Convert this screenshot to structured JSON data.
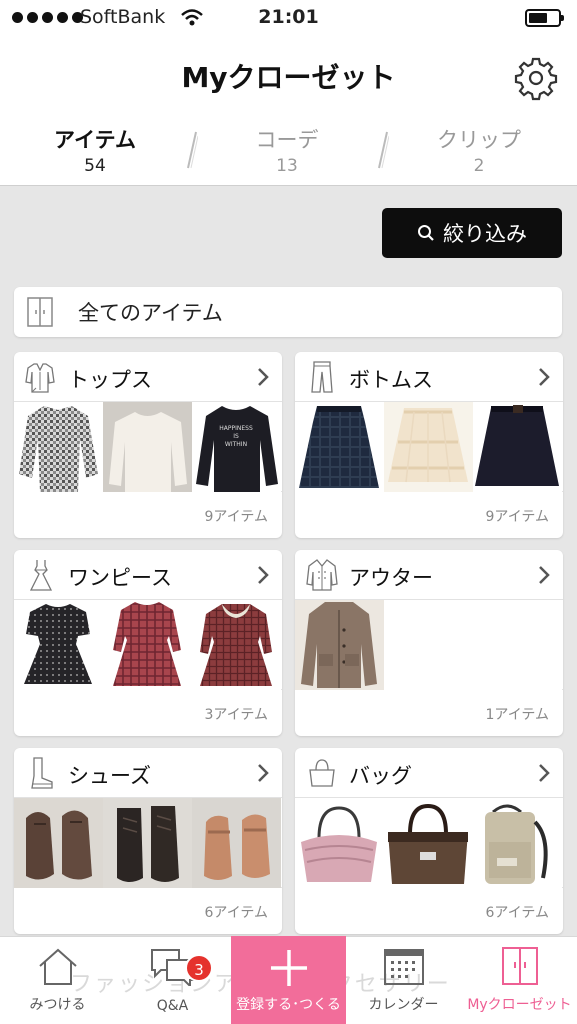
{
  "status_bar": {
    "carrier": "SoftBank",
    "time": "21:01"
  },
  "header": {
    "title": "Myクローゼット"
  },
  "tabs": [
    {
      "label": "アイテム",
      "count": "54",
      "active": true
    },
    {
      "label": "コーデ",
      "count": "13",
      "active": false
    },
    {
      "label": "クリップ",
      "count": "2",
      "active": false
    }
  ],
  "filter_button": {
    "label": "絞り込み"
  },
  "all_items": {
    "label": "全てのアイテム"
  },
  "categories": [
    {
      "name": "トップス",
      "count_label": "9アイテム",
      "icon": "shirt-icon"
    },
    {
      "name": "ボトムス",
      "count_label": "9アイテム",
      "icon": "pants-icon"
    },
    {
      "name": "ワンピース",
      "count_label": "3アイテム",
      "icon": "dress-icon"
    },
    {
      "name": "アウター",
      "count_label": "1アイテム",
      "icon": "coat-icon"
    },
    {
      "name": "シューズ",
      "count_label": "6アイテム",
      "icon": "boot-icon"
    },
    {
      "name": "バッグ",
      "count_label": "6アイテム",
      "icon": "handbag-icon"
    }
  ],
  "thumb_text": {
    "sweater_print_1": "HAPPINESS",
    "sweater_print_2": "IS",
    "sweater_print_3": "WITHIN"
  },
  "background_text": "ファッションアイテムアクセサリー",
  "tab_bar": [
    {
      "label": "みつける",
      "icon": "house-icon"
    },
    {
      "label": "Q&A",
      "icon": "chat-bubbles-icon",
      "badge": "3"
    },
    {
      "label": "登録する･つくる",
      "icon": "plus-icon"
    },
    {
      "label": "カレンダー",
      "icon": "calendar-icon"
    },
    {
      "label": "Myクローゼット",
      "icon": "closet-icon"
    }
  ],
  "colors": {
    "accent_pink": "#f26d9a",
    "active_pink": "#ee5f93",
    "badge_red": "#e5322d",
    "background_gray": "#e6e6e6"
  }
}
